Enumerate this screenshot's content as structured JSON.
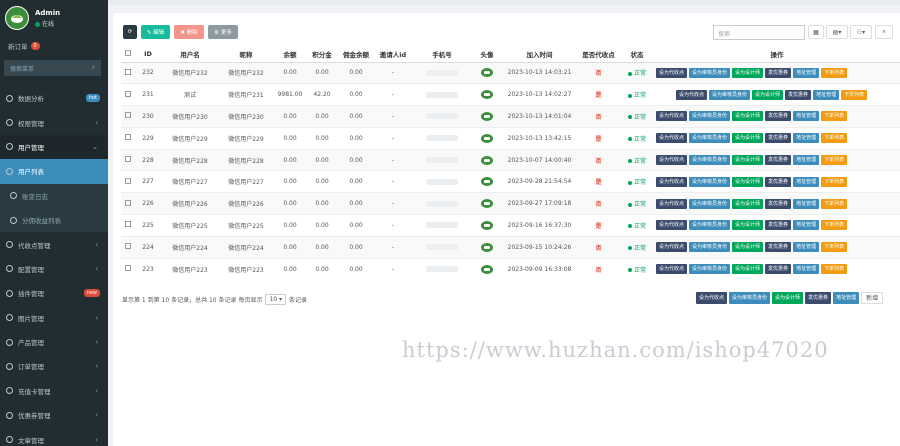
{
  "user": {
    "name": "Admin",
    "status": "在线"
  },
  "sidebar": {
    "orders_label": "新订单",
    "orders_count": "0",
    "search_placeholder": "搜索菜单",
    "items": [
      {
        "label": "数据分析",
        "tag": "hot",
        "tag_color": "#3c8dbc",
        "cls": ""
      },
      {
        "label": "权限管理",
        "caret": "‹",
        "cls": ""
      },
      {
        "label": "用户管理",
        "caret": "⌄",
        "cls": "open"
      },
      {
        "label": "用户列表",
        "cls": "active"
      },
      {
        "label": "账变日志",
        "cls": "sub"
      },
      {
        "label": "分佣收益列表",
        "cls": "sub"
      },
      {
        "label": "代收点管理",
        "caret": "‹",
        "cls": ""
      },
      {
        "label": "配置管理",
        "caret": "‹",
        "cls": ""
      },
      {
        "label": "插件管理",
        "tag": "new",
        "tag_color": "#dd4b39",
        "cls": ""
      },
      {
        "label": "图片管理",
        "caret": "‹",
        "cls": ""
      },
      {
        "label": "产品管理",
        "caret": "‹",
        "cls": ""
      },
      {
        "label": "订单管理",
        "caret": "‹",
        "cls": ""
      },
      {
        "label": "充值卡管理",
        "caret": "‹",
        "cls": ""
      },
      {
        "label": "优惠券管理",
        "caret": "‹",
        "cls": ""
      },
      {
        "label": "文章管理",
        "caret": "‹",
        "cls": ""
      }
    ]
  },
  "toolbar": {
    "refresh": "⟳",
    "edit": "✎ 编辑",
    "delete": "✖ 删除",
    "more": "⚙ 更多",
    "search_placeholder": "搜索",
    "columns_icon": "▦",
    "export_icon": "▤▾",
    "user_icon": "⚇▾",
    "search_icon": "⌕"
  },
  "colors": {
    "sidebar_bg": "#222d32",
    "accent": "#3c8dbc",
    "success": "#00a65a",
    "danger": "#dd4b39",
    "warning": "#f39c12",
    "dark": "#605ca8"
  },
  "table": {
    "columns": [
      "",
      "ID",
      "用户名",
      "昵称",
      "余额",
      "积分金",
      "佣金余额",
      "邀请人id",
      "手机号",
      "头像",
      "加入时间",
      "是否代收点",
      "状态",
      "操作"
    ],
    "rows": [
      {
        "id": "232",
        "username": "微信用户232",
        "nickname": "微信用户232",
        "balance": "0.00",
        "points": "0.00",
        "commission": "0.00",
        "inviter": "-",
        "joined": "2023-10-13 14:03:21",
        "agent": "否",
        "status": "正常"
      },
      {
        "id": "231",
        "username": "测试",
        "nickname": "微信用户231",
        "balance": "9981.00",
        "points": "42.20",
        "commission": "0.00",
        "inviter": "-",
        "joined": "2023-10-13 14:02:27",
        "agent": "是",
        "status": "正常"
      },
      {
        "id": "230",
        "username": "微信用户230",
        "nickname": "微信用户230",
        "balance": "0.00",
        "points": "0.00",
        "commission": "0.00",
        "inviter": "-",
        "joined": "2023-10-13 14:01:04",
        "agent": "否",
        "status": "正常"
      },
      {
        "id": "229",
        "username": "微信用户229",
        "nickname": "微信用户229",
        "balance": "0.00",
        "points": "0.00",
        "commission": "0.00",
        "inviter": "-",
        "joined": "2023-10-13 13:42:15",
        "agent": "是",
        "status": "正常"
      },
      {
        "id": "228",
        "username": "微信用户228",
        "nickname": "微信用户228",
        "balance": "0.00",
        "points": "0.00",
        "commission": "0.00",
        "inviter": "-",
        "joined": "2023-10-07 14:00:40",
        "agent": "否",
        "status": "正常"
      },
      {
        "id": "227",
        "username": "微信用户227",
        "nickname": "微信用户227",
        "balance": "0.00",
        "points": "0.00",
        "commission": "0.00",
        "inviter": "-",
        "joined": "2023-09-28 21:54:54",
        "agent": "是",
        "status": "正常"
      },
      {
        "id": "226",
        "username": "微信用户226",
        "nickname": "微信用户226",
        "balance": "0.00",
        "points": "0.00",
        "commission": "0.00",
        "inviter": "-",
        "joined": "2023-09-27 17:09:18",
        "agent": "否",
        "status": "正常"
      },
      {
        "id": "225",
        "username": "微信用户225",
        "nickname": "微信用户225",
        "balance": "0.00",
        "points": "0.00",
        "commission": "0.00",
        "inviter": "-",
        "joined": "2023-09-16 16:37:30",
        "agent": "是",
        "status": "正常"
      },
      {
        "id": "224",
        "username": "微信用户224",
        "nickname": "微信用户224",
        "balance": "0.00",
        "points": "0.00",
        "commission": "0.00",
        "inviter": "-",
        "joined": "2023-09-15 10:24:26",
        "agent": "否",
        "status": "正常"
      },
      {
        "id": "223",
        "username": "微信用户223",
        "nickname": "微信用户223",
        "balance": "0.00",
        "points": "0.00",
        "commission": "0.00",
        "inviter": "-",
        "joined": "2023-09-09 16:33:08",
        "agent": "否",
        "status": "正常"
      }
    ]
  },
  "actions": {
    "set_agent": "设为代收点",
    "set_default": "设为审核员身份",
    "set_designer": "设为设计师",
    "send_coupon": "发优惠券",
    "address": "地址管理",
    "order": "下单列表"
  },
  "action_colors": {
    "set_agent": "#3a4b6b",
    "set_default": "#3c8dbc",
    "set_designer": "#00a65a",
    "send_coupon": "#3a4b6b",
    "address": "#3c8dbc",
    "order": "#f39c12"
  },
  "pager": {
    "summary": "显示第 1 到第 10 条记录，总共 10 条记录 每页显示",
    "page_size": "10 ▾",
    "suffix": "条记录"
  },
  "last_row": {
    "inviter": "-",
    "joined": "2023-09-09 16:33:08",
    "last_btn": "新增"
  },
  "watermark": "https://www.huzhan.com/ishop47020"
}
